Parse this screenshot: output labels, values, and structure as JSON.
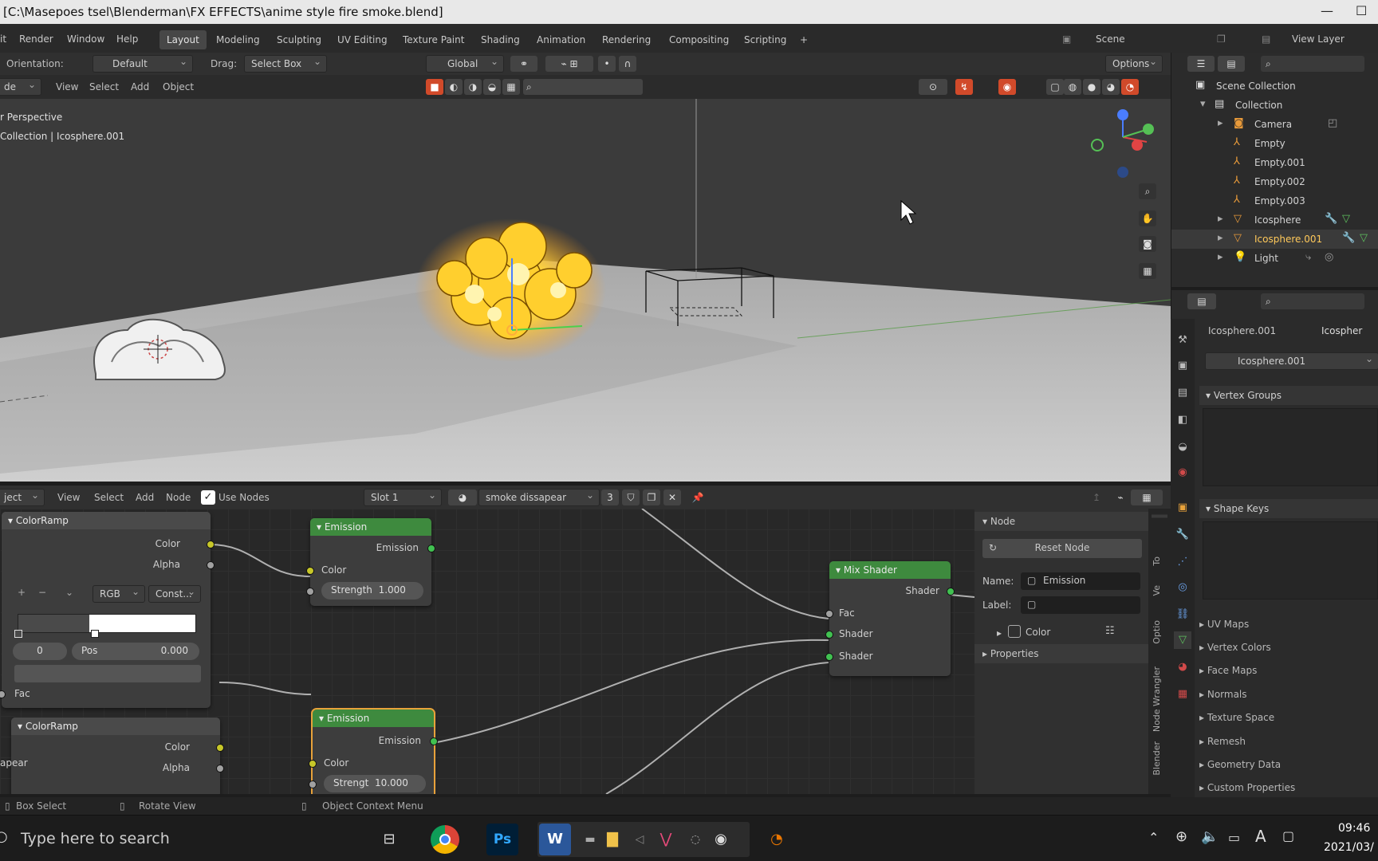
{
  "window": {
    "title": "[C:\\Masepoes tsel\\Blenderman\\FX EFFECTS\\anime style fire smoke.blend]"
  },
  "menus": [
    "Render",
    "Window",
    "Help"
  ],
  "workspaces": [
    "Layout",
    "Modeling",
    "Sculpting",
    "UV Editing",
    "Texture Paint",
    "Shading",
    "Animation",
    "Rendering",
    "Compositing",
    "Scripting"
  ],
  "scene": {
    "scene_label": "Scene",
    "view_layer_label": "View Layer"
  },
  "viewport": {
    "orientation_label": "Orientation:",
    "orientation_value": "Default",
    "drag_label": "Drag:",
    "drag_value": "Select Box",
    "transform_value": "Global",
    "options_label": "Options",
    "mode_value": "de",
    "menu": [
      "View",
      "Select",
      "Add",
      "Object"
    ],
    "overlay_line1": "r Perspective",
    "overlay_line2": "Collection | Icosphere.001"
  },
  "outliner": {
    "root": "Scene Collection",
    "collection": "Collection",
    "items": [
      {
        "name": "Camera",
        "icon": "camera-icon"
      },
      {
        "name": "Empty",
        "icon": "empty-icon"
      },
      {
        "name": "Empty.001",
        "icon": "empty-icon"
      },
      {
        "name": "Empty.002",
        "icon": "empty-icon"
      },
      {
        "name": "Empty.003",
        "icon": "empty-icon"
      },
      {
        "name": "Icosphere",
        "icon": "mesh-icon"
      },
      {
        "name": "Icosphere.001",
        "icon": "mesh-icon",
        "selected": true
      },
      {
        "name": "Light",
        "icon": "light-icon"
      }
    ]
  },
  "properties": {
    "object_name": "Icosphere.001",
    "object_name_cut": "Icospher",
    "mesh_name": "Icosphere.001",
    "panels": [
      "Vertex Groups",
      "Shape Keys"
    ],
    "collapsed": [
      "UV Maps",
      "Vertex Colors",
      "Face Maps",
      "Normals",
      "Texture Space",
      "Remesh",
      "Geometry Data",
      "Custom Properties"
    ]
  },
  "node_editor": {
    "object_value": "ject",
    "menu": [
      "View",
      "Select",
      "Add",
      "Node"
    ],
    "use_nodes_label": "Use Nodes",
    "slot_value": "Slot 1",
    "material_name": "smoke dissapear",
    "user_count": "3",
    "nodes": {
      "colorramp1": {
        "title": "ColorRamp",
        "out_color": "Color",
        "out_alpha": "Alpha",
        "mode": "RGB",
        "interp": "Const...",
        "index": "0",
        "pos_label": "Pos",
        "pos_value": "0.000",
        "in_fac": "Fac",
        "btn_add": "+",
        "btn_remove": "−"
      },
      "emission1": {
        "title": "Emission",
        "out": "Emission",
        "in_color": "Color",
        "strength": "Strength",
        "strength_value": "1.000"
      },
      "colorramp2": {
        "title": "ColorRamp",
        "out_color": "Color",
        "out_alpha": "Alpha",
        "side_label": "apear"
      },
      "emission2": {
        "title": "Emission",
        "out": "Emission",
        "in_color": "Color",
        "strength": "Strengt",
        "strength_value": "10.000"
      },
      "mixshader": {
        "title": "Mix Shader",
        "out": "Shader",
        "in_fac": "Fac",
        "in_shader1": "Shader",
        "in_shader2": "Shader"
      }
    },
    "side_panel": {
      "section": "Node",
      "reset_label": "Reset Node",
      "name_label": "Name:",
      "name_value": "Emission",
      "label_label": "Label:",
      "label_value": "",
      "color_label": "Color",
      "properties_label": "Properties"
    },
    "side_tabs": [
      "Blender",
      "Node Wrangler",
      "Optio",
      "Ve",
      "To"
    ]
  },
  "statusbar": {
    "left": "Box Select",
    "middle": "Rotate View",
    "right": "Object Context Menu"
  },
  "taskbar": {
    "search_placeholder": "Type here to search",
    "time": "09:46",
    "date": "2021/03/",
    "ps_label": "Ps",
    "word_label": "W"
  },
  "colors": {
    "accent_orange": "#e8a23a",
    "node_green": "#3e8a3e",
    "selected_text": "#ffc95a"
  }
}
